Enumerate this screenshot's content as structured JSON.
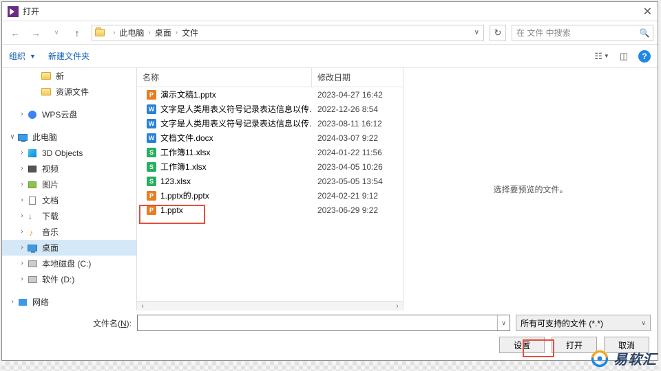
{
  "window": {
    "title": "打开"
  },
  "nav": {
    "crumbs": [
      "此电脑",
      "桌面",
      "文件"
    ],
    "search_placeholder": "在 文件 中搜索"
  },
  "toolbar": {
    "organize": "组织",
    "new_folder": "新建文件夹"
  },
  "sidebar": {
    "items": [
      {
        "label": "新",
        "icon": "folder",
        "indent": 38
      },
      {
        "label": "资源文件",
        "icon": "folder",
        "indent": 38
      },
      {
        "label": "",
        "spacer": true
      },
      {
        "label": "WPS云盘",
        "icon": "wps",
        "indent": 18,
        "exp": ">"
      },
      {
        "label": "",
        "spacer": true
      },
      {
        "label": "此电脑",
        "icon": "pc",
        "indent": 4,
        "exp": "v",
        "bold": true
      },
      {
        "label": "3D Objects",
        "icon": "3d",
        "indent": 18,
        "exp": ">"
      },
      {
        "label": "视频",
        "icon": "vid",
        "indent": 18,
        "exp": ">"
      },
      {
        "label": "图片",
        "icon": "img",
        "indent": 18,
        "exp": ">"
      },
      {
        "label": "文档",
        "icon": "doc",
        "indent": 18,
        "exp": ">"
      },
      {
        "label": "下载",
        "icon": "dl",
        "indent": 18,
        "exp": ">"
      },
      {
        "label": "音乐",
        "icon": "mus",
        "indent": 18,
        "exp": ">"
      },
      {
        "label": "桌面",
        "icon": "pc",
        "indent": 18,
        "exp": ">",
        "selected": true
      },
      {
        "label": "本地磁盘 (C:)",
        "icon": "disk",
        "indent": 18,
        "exp": ">"
      },
      {
        "label": "软件 (D:)",
        "icon": "disk",
        "indent": 18,
        "exp": ">"
      },
      {
        "label": "",
        "spacer": true
      },
      {
        "label": "网络",
        "icon": "net",
        "indent": 4,
        "exp": ">"
      }
    ]
  },
  "columns": {
    "name": "名称",
    "modified": "修改日期"
  },
  "files": [
    {
      "name": "演示文稿1.pptx",
      "type": "ppt",
      "date": "2023-04-27 16:42"
    },
    {
      "name": "文字是人类用表义符号记录表达信息以传...",
      "type": "doc",
      "date": "2022-12-26 8:54"
    },
    {
      "name": "文字是人类用表义符号记录表达信息以传...",
      "type": "doc",
      "date": "2023-08-11 16:12"
    },
    {
      "name": "文档文件.docx",
      "type": "doc",
      "date": "2024-03-07 9:22"
    },
    {
      "name": "工作簿11.xlsx",
      "type": "xls",
      "date": "2024-01-22 11:56"
    },
    {
      "name": "工作簿1.xlsx",
      "type": "xls",
      "date": "2023-04-05 10:26"
    },
    {
      "name": "123.xlsx",
      "type": "xls",
      "date": "2023-05-05 13:54"
    },
    {
      "name": "1.pptx的.pptx",
      "type": "ppt",
      "date": "2024-02-21 9:12"
    },
    {
      "name": "1.pptx",
      "type": "ppt",
      "date": "2023-06-29 9:22"
    }
  ],
  "preview_msg": "选择要预览的文件。",
  "footer": {
    "filename_label_pre": "文件名(",
    "filename_label_u": "N",
    "filename_label_post": "):",
    "filter": "所有可支持的文件 (*.*)",
    "settings": "设置",
    "open": "打开",
    "cancel": "取消"
  },
  "watermark": "易软汇"
}
